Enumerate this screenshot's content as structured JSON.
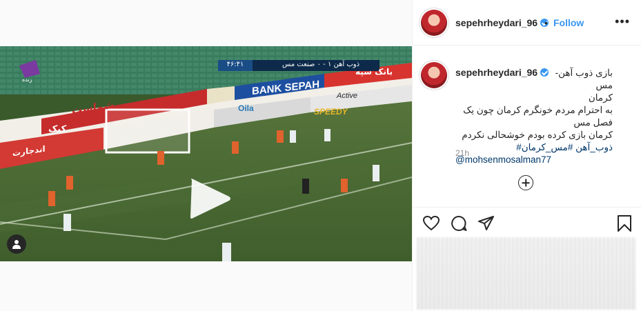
{
  "post": {
    "username": "sepehrheydari_96",
    "follow_label": "Follow",
    "separator": "•",
    "more_label": "•••",
    "caption": {
      "line1": "بازی ذوب آهن-مس",
      "line2": "کرمان",
      "line3": "به احترام مردم خونگرم کرمان چون یک فصل مس",
      "line4": "کرمان بازی کرده بودم خوشحالی نکردم",
      "hashtags": "ذوب_آهن #مس_کرمان#",
      "mention": "@mohsenmosalman77"
    },
    "time": "21h"
  },
  "video": {
    "scoreboard": "ذوب آهن ۱ - ۰ صنعت مس",
    "clock": "۴۶:۴۱",
    "channel_label": "زنده",
    "ads": [
      "بانک سپه",
      "BANK SEPAH",
      "Active",
      "SPEEDY",
      "Oila",
      "شماست",
      "کیک",
      "اندجارت"
    ]
  },
  "icons": {
    "verified": "verified-badge-icon",
    "play": "play-icon",
    "user_tag": "user-tag-icon",
    "add_comment": "plus-circle-icon",
    "like": "heart-icon",
    "comment": "comment-bubble-icon",
    "share": "paper-plane-icon",
    "save": "bookmark-icon"
  },
  "colors": {
    "accent": "#3897f0",
    "link": "#00376b",
    "text": "#262626",
    "muted": "#8e8e8e"
  }
}
